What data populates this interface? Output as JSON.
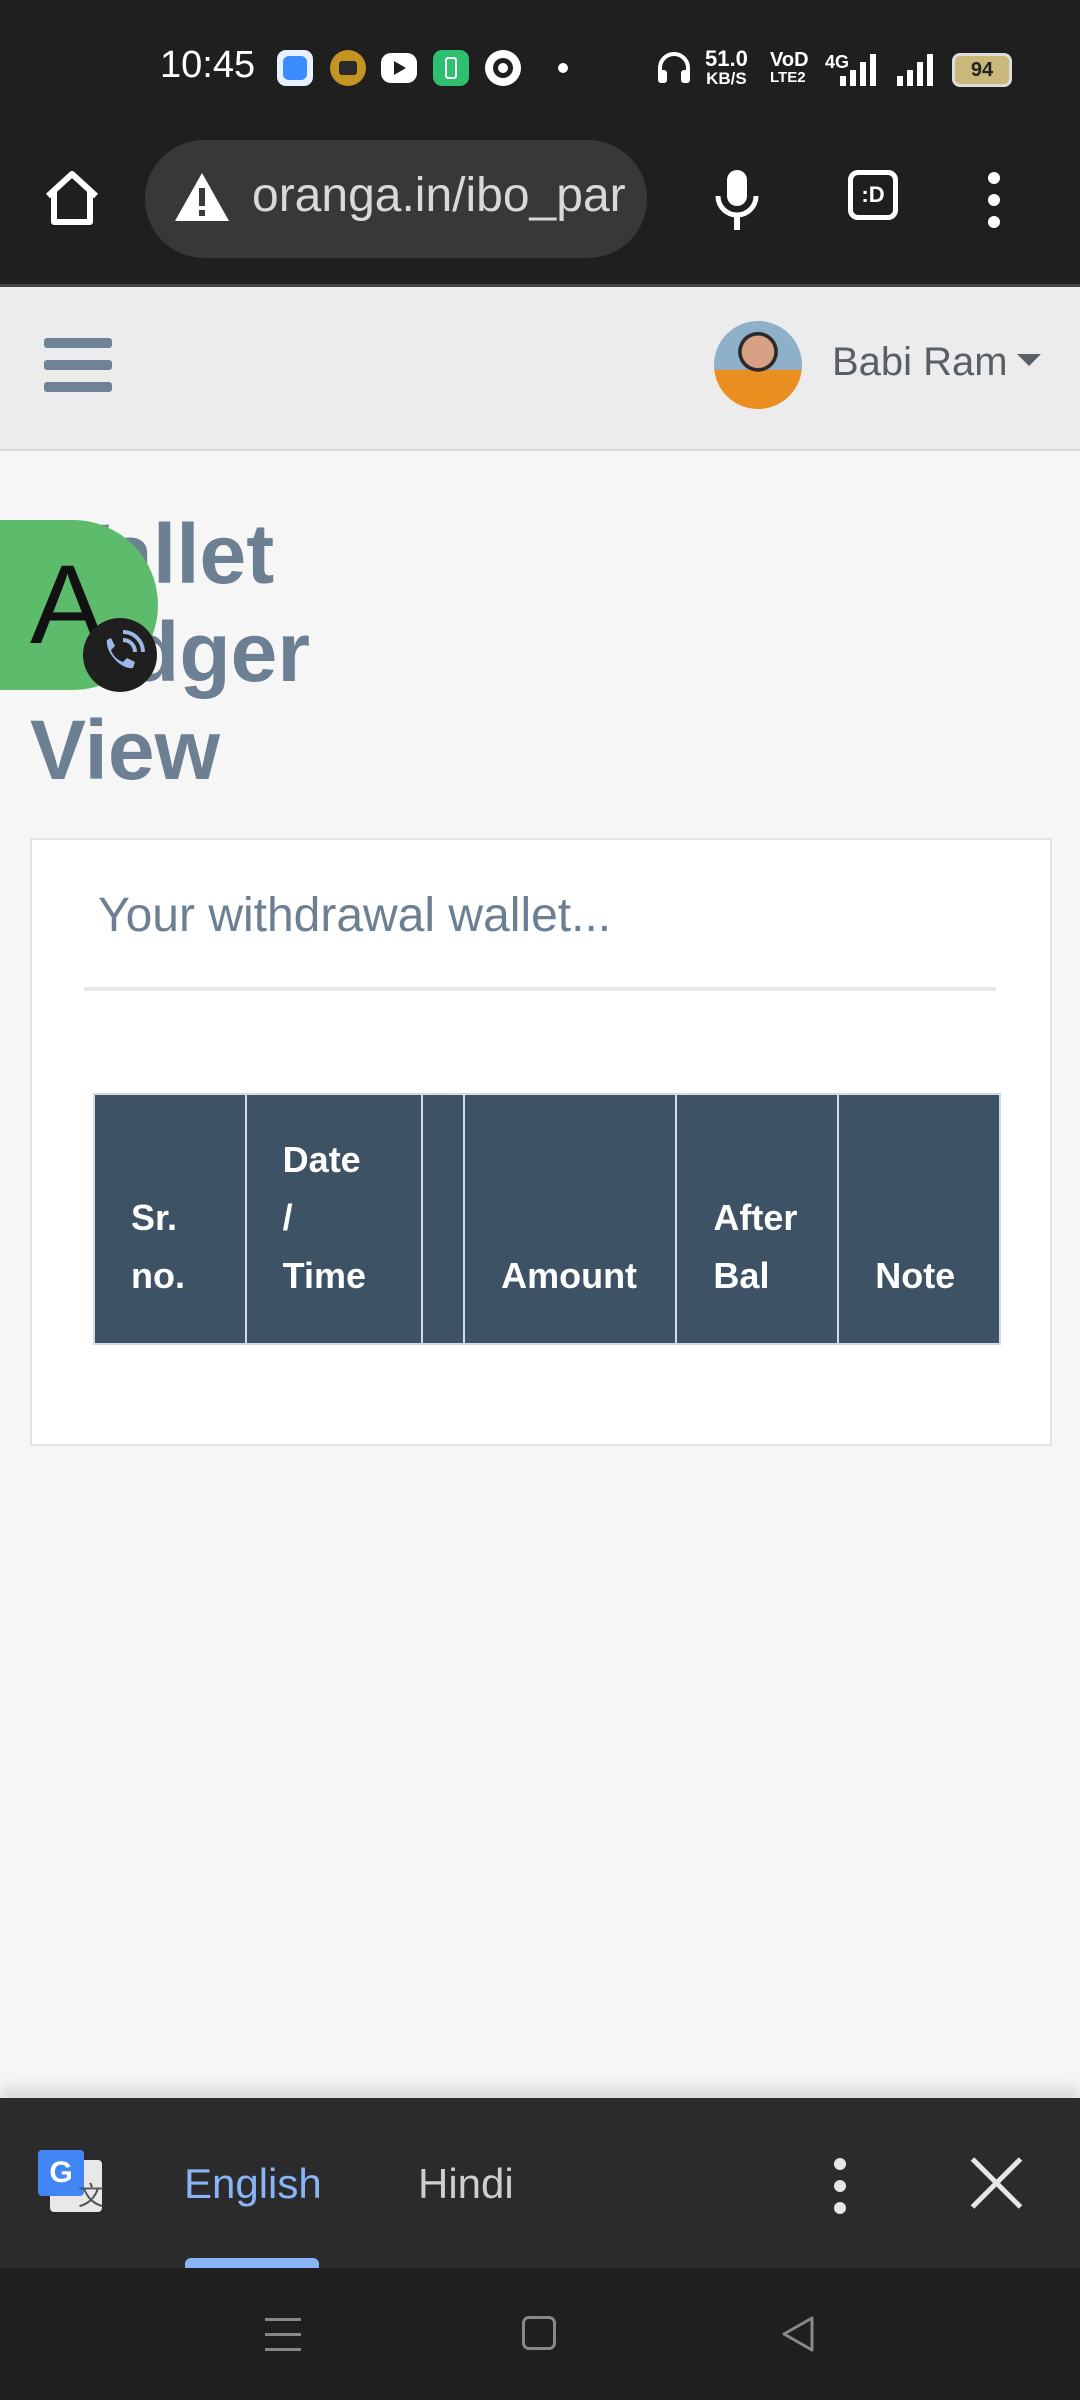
{
  "status_bar": {
    "time": "10:45",
    "speed_value": "51.0",
    "speed_unit": "KB/S",
    "volte_top": "VoD",
    "volte_bottom": "LTE2",
    "network": "4G",
    "battery": "94",
    "notification_icons": [
      "messenger-icon",
      "app-icon",
      "youtube-icon",
      "battery-saver-icon",
      "circle-app-icon",
      "dot-icon"
    ]
  },
  "browser": {
    "url": "oranga.in/ibo_par",
    "icons": [
      "home-icon",
      "warning-icon",
      "mic-icon",
      "tab-switcher-icon",
      "more-icon"
    ],
    "tab_label": ":D"
  },
  "header": {
    "user_name": "Babi Ram"
  },
  "page": {
    "title_lines": [
      "Wallet",
      "Ledger",
      "View"
    ],
    "card_subtitle": "Your withdrawal wallet...",
    "table": {
      "columns": [
        [
          "Sr.",
          "no."
        ],
        [
          "Date",
          "/",
          "Time"
        ],
        [
          ""
        ],
        [
          "Amount"
        ],
        [
          "After",
          "Bal"
        ],
        [
          "Note"
        ]
      ]
    }
  },
  "bubble": {
    "letter": "A"
  },
  "translate_bar": {
    "lang_active": "English",
    "lang_other": "Hindi"
  },
  "colors": {
    "table_header": "#3e5266",
    "title": "#6c7f93",
    "accent_blue": "#8ab4f8",
    "bubble_green": "#5dbb6c"
  }
}
